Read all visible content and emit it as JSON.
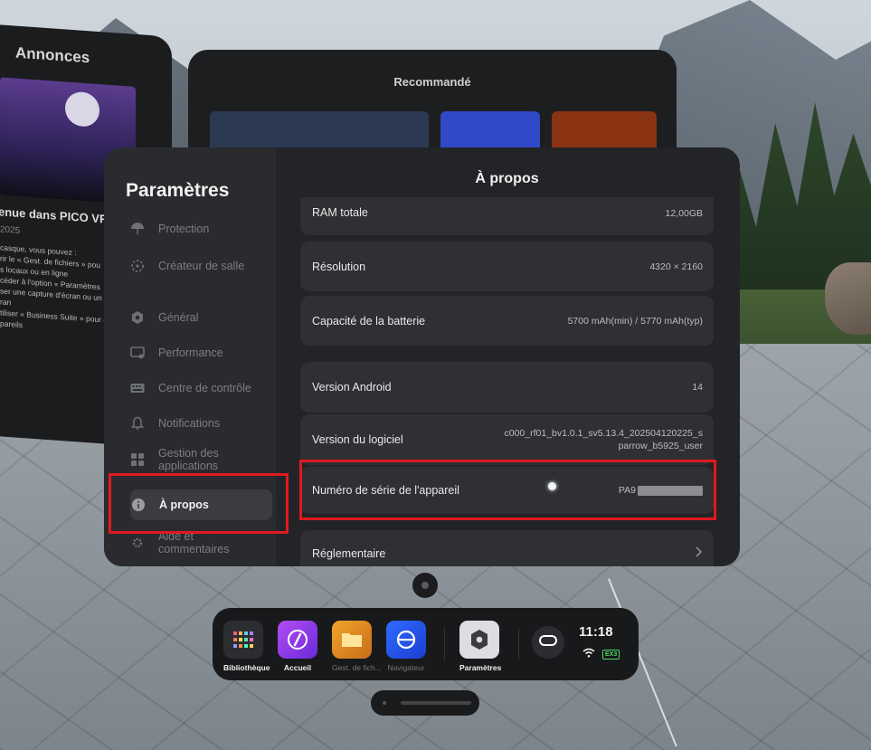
{
  "background_panels": {
    "annonces_title": "Annonces",
    "annonce_heading": "enue dans PICO VR",
    "annonce_date": "2025",
    "annonce_lines": [
      "casque, vous pouvez :",
      "rir le « Gest. de fichiers » pou",
      "s locaux ou en ligne",
      "céder à l'option « Paramètres",
      "ser une capture d'écran ou un c",
      "ran",
      "tiliser « Business Suite » pour g",
      "pareils"
    ],
    "recommande_title": "Recommandé"
  },
  "settings": {
    "title": "Paramètres",
    "nav": [
      {
        "label": "Protection",
        "icon": "umbrella-icon"
      },
      {
        "label": "Créateur de salle",
        "icon": "boundary-icon"
      },
      {
        "label": "Général",
        "icon": "gear-icon"
      },
      {
        "label": "Performance",
        "icon": "monitor-icon"
      },
      {
        "label": "Centre de contrôle",
        "icon": "keyboard-icon"
      },
      {
        "label": "Notifications",
        "icon": "bell-icon"
      },
      {
        "label": "Gestion des applications",
        "icon": "apps-grid-icon"
      },
      {
        "label": "À propos",
        "icon": "info-icon",
        "active": true
      },
      {
        "label": "Aide et commentaires",
        "icon": "help-icon"
      }
    ],
    "page_title": "À propos",
    "rows": [
      {
        "key": "RAM totale",
        "value": "12,00GB"
      },
      {
        "key": "Résolution",
        "value": "4320 × 2160"
      },
      {
        "key": "Capacité de la batterie",
        "value": "5700 mAh(min) / 5770 mAh(typ)"
      },
      {
        "key": "Version Android",
        "value": "14"
      },
      {
        "key": "Version du logiciel",
        "value_line1": "c000_rf01_bv1.0.1_sv5.13.4_202504120225_s",
        "value_line2": "parrow_b5925_user"
      },
      {
        "key": "Numéro de série de l'appareil",
        "value_prefix": "PA9"
      },
      {
        "key": "Réglementaire",
        "value": ""
      }
    ]
  },
  "taskbar": {
    "apps": [
      {
        "label": "Bibliothèque",
        "icon": "library-grid-icon",
        "active": true
      },
      {
        "label": "Accueil",
        "icon": "compass-icon",
        "active": true
      },
      {
        "label": "Gest. de fich...",
        "icon": "folder-icon",
        "active": false
      },
      {
        "label": "Navigateur",
        "icon": "browser-icon",
        "active": false
      },
      {
        "label": "Paramètres",
        "icon": "settings-hex-icon",
        "active": true
      }
    ],
    "time": "11:18",
    "battery_label": "EX3"
  },
  "colors": {
    "highlight": "#e0191f",
    "panel": "#232427",
    "sidebar": "#2a2b2e",
    "row": "#2f3033",
    "battery": "#4cd964"
  }
}
